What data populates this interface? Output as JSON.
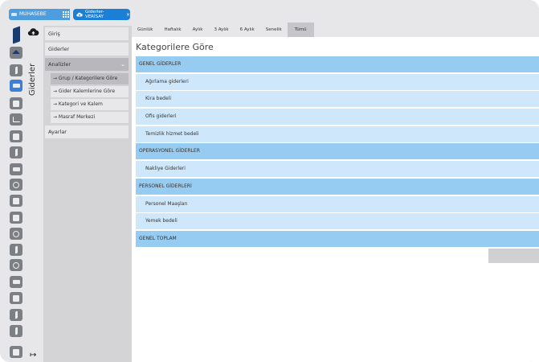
{
  "window": {
    "brand_label": "MUHASEBE",
    "page_tab_label": "Giderler- VERİSAY",
    "close_glyph": "×"
  },
  "icons": {
    "exit_glyph": "↦"
  },
  "secondary": {
    "vertical_title": "Giderler"
  },
  "menu": {
    "items": [
      {
        "label": "Giriş"
      },
      {
        "label": "Giderler"
      },
      {
        "label": "Analizler",
        "expanded_glyph": "⌄"
      },
      {
        "label": "Ayarlar"
      }
    ],
    "sub_items": [
      {
        "label": "→ Grup / Kategorilere Göre"
      },
      {
        "label": "→ Gider Kalemlerine Göre"
      },
      {
        "label": "→ Kategori ve Kalem"
      },
      {
        "label": "→ Masraf Merkezi"
      }
    ]
  },
  "periods": [
    "Günlük",
    "Haftalık",
    "Aylık",
    "3 Aylık",
    "6 Aylık",
    "Senelik",
    "Tümü"
  ],
  "content": {
    "title": "Kategorilere Göre",
    "rows": [
      {
        "type": "group",
        "label": "GENEL GİDERLER"
      },
      {
        "type": "item",
        "label": "Ağırlama giderleri"
      },
      {
        "type": "item",
        "label": "Kira bedeli"
      },
      {
        "type": "item",
        "label": "Ofis giderleri"
      },
      {
        "type": "item",
        "label": "Temizlik hizmet bedeli"
      },
      {
        "type": "group",
        "label": "OPERASYONEL GİDERLER"
      },
      {
        "type": "item",
        "label": "Nakliye Giderleri"
      },
      {
        "type": "group",
        "label": "PERSONEL GİDERLERİ"
      },
      {
        "type": "item",
        "label": "Personel Maaşları"
      },
      {
        "type": "item",
        "label": "Yemek bedeli"
      },
      {
        "type": "total",
        "label": "GENEL TOPLAM"
      }
    ]
  }
}
